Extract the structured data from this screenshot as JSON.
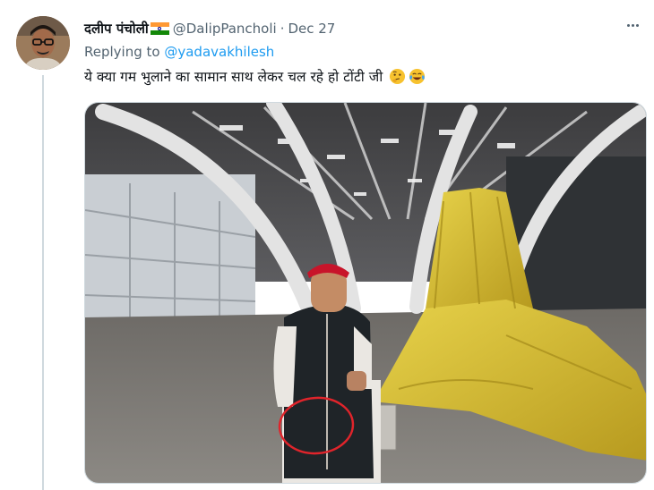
{
  "tweet": {
    "author_name": "दलीप पंचोली",
    "flag_icon": "india-flag-icon",
    "handle": "@DalipPancholi",
    "separator": "·",
    "date": "Dec 27",
    "reply_prefix": "Replying to",
    "reply_to": "@yadavakhilesh",
    "text": "ये क्या गम भुलाने का सामान साथ लेकर चल रहे हो टोंटी जी",
    "emojis": [
      "thinking-face-icon",
      "face-with-tears-of-joy-icon"
    ],
    "more_icon": "more-options-icon"
  },
  "colors": {
    "link": "#1d9bf0",
    "secondary_text": "#536471",
    "annotation_circle": "#e0242b",
    "tarp_yellow": "#d9c23a"
  }
}
